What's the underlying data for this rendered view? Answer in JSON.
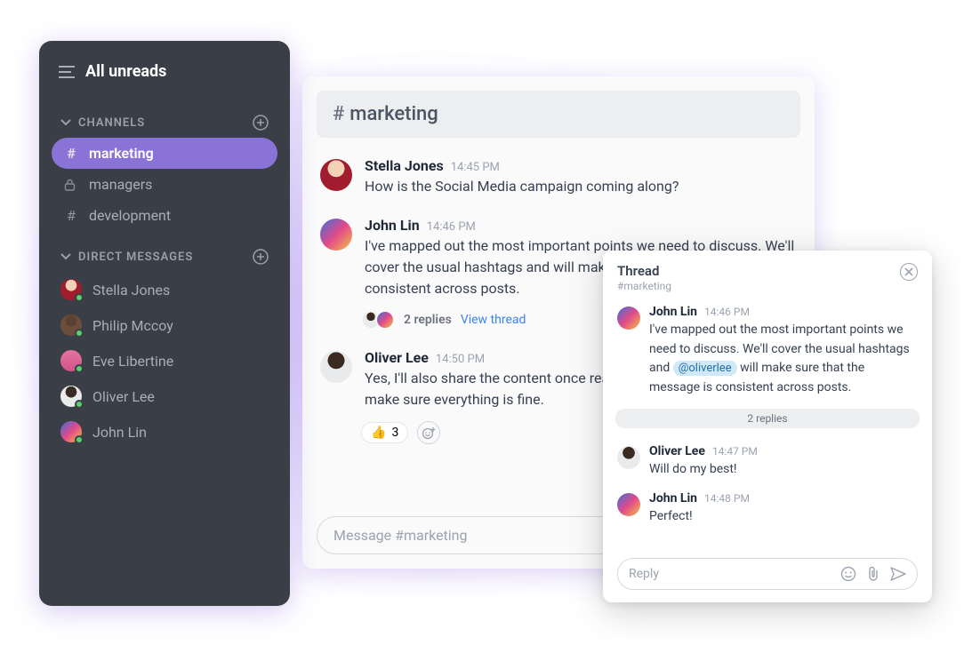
{
  "sidebar": {
    "title": "All unreads",
    "sections": {
      "channels": {
        "label": "CHANNELS",
        "items": [
          {
            "name": "marketing",
            "icon": "hash",
            "active": true
          },
          {
            "name": "managers",
            "icon": "lock",
            "active": false
          },
          {
            "name": "development",
            "icon": "hash",
            "active": false
          }
        ]
      },
      "dms": {
        "label": "DIRECT MESSAGES",
        "items": [
          {
            "name": "Stella Jones"
          },
          {
            "name": "Philip Mccoy"
          },
          {
            "name": "Eve Libertine"
          },
          {
            "name": "Oliver Lee"
          },
          {
            "name": "John Lin"
          }
        ]
      }
    }
  },
  "channel": {
    "hash": "#",
    "name": "marketing",
    "compose_placeholder": "Message #marketing"
  },
  "messages": [
    {
      "author": "Stella Jones",
      "time": "14:45 PM",
      "text": " How is the Social Media campaign coming along?"
    },
    {
      "author": "John Lin",
      "time": "14:46 PM",
      "text": "I've mapped out the most important points we need to discuss. We'll cover the usual hashtags and will make sure that the message is consistent across posts.",
      "replies_label": "2 replies",
      "view_thread": "View thread"
    },
    {
      "author": "Oliver Lee",
      "time": "14:50 PM",
      "text": "Yes, I'll also share the content once ready so you can take a look and make sure everything is fine.",
      "reaction_emoji": "👍",
      "reaction_count": "3"
    }
  ],
  "thread": {
    "title": "Thread",
    "subtitle": "#marketing",
    "root": {
      "author": "John Lin",
      "time": "14:46 PM",
      "text_before": "I've mapped out the most important points we need to discuss. We'll cover the usual hashtags and ",
      "mention": "@oliverlee",
      "text_after": " will make sure that the message is consistent across posts."
    },
    "divider": "2 replies",
    "replies": [
      {
        "author": "Oliver Lee",
        "time": "14:47 PM",
        "text": "Will do my best!"
      },
      {
        "author": "John Lin",
        "time": "14:48 PM",
        "text": "Perfect!"
      }
    ],
    "compose_placeholder": "Reply"
  }
}
